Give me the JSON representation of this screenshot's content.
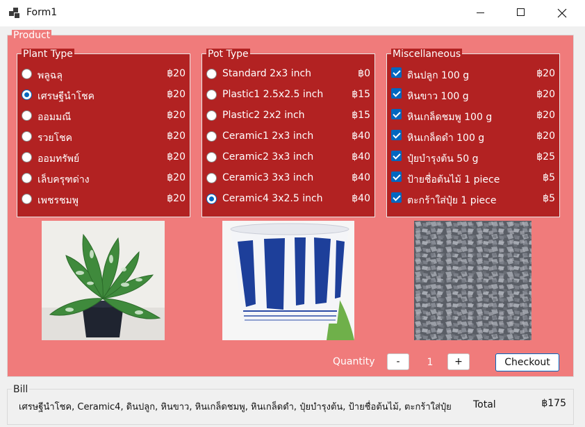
{
  "window": {
    "title": "Form1"
  },
  "product": {
    "legend": "Product",
    "plant": {
      "legend": "Plant Type",
      "options": [
        {
          "label": "พลูฉลุ",
          "price": "฿20",
          "selected": false
        },
        {
          "label": "เศรษฐีนำโชค",
          "price": "฿20",
          "selected": true
        },
        {
          "label": "ออมมณี",
          "price": "฿20",
          "selected": false
        },
        {
          "label": "รวยโชค",
          "price": "฿20",
          "selected": false
        },
        {
          "label": "ออมทรัพย์",
          "price": "฿20",
          "selected": false
        },
        {
          "label": "เล็บครุฑด่าง",
          "price": "฿20",
          "selected": false
        },
        {
          "label": "เพชรชมพู",
          "price": "฿20",
          "selected": false
        }
      ]
    },
    "pot": {
      "legend": "Pot Type",
      "options": [
        {
          "label": "Standard 2x3 inch",
          "price": "฿0",
          "selected": false
        },
        {
          "label": "Plastic1 2.5x2.5 inch",
          "price": "฿15",
          "selected": false
        },
        {
          "label": "Plastic2 2x2 inch",
          "price": "฿15",
          "selected": false
        },
        {
          "label": "Ceramic1 2x3 inch",
          "price": "฿40",
          "selected": false
        },
        {
          "label": "Ceramic2 3x3 inch",
          "price": "฿40",
          "selected": false
        },
        {
          "label": "Ceramic3 3x3 inch",
          "price": "฿40",
          "selected": false
        },
        {
          "label": "Ceramic4 3x2.5 inch",
          "price": "฿40",
          "selected": true
        }
      ]
    },
    "misc": {
      "legend": "Miscellaneous",
      "options": [
        {
          "label": "ดินปลูก 100 g",
          "price": "฿20",
          "checked": true
        },
        {
          "label": "หินขาว 100 g",
          "price": "฿20",
          "checked": true
        },
        {
          "label": "หินเกล็ดชมพู 100 g",
          "price": "฿20",
          "checked": true
        },
        {
          "label": "หินเกล็ดดำ 100 g",
          "price": "฿20",
          "checked": true
        },
        {
          "label": "ปุ๋ยบำรุงต้น 50 g",
          "price": "฿25",
          "checked": true
        },
        {
          "label": "ป้ายชื่อต้นไม้ 1 piece",
          "price": "฿5",
          "checked": true
        },
        {
          "label": "ตะกร้าใส่ปุ๋ย 1 piece",
          "price": "฿5",
          "checked": true
        }
      ]
    },
    "quantity": {
      "label": "Quantity",
      "minus": "-",
      "value": "1",
      "plus": "+"
    },
    "checkout_label": "Checkout"
  },
  "bill": {
    "legend": "Bill",
    "items": "เศรษฐีนำโชค, Ceramic4, ดินปลูก, หินขาว, หินเกล็ดชมพู, หินเกล็ดดำ, ปุ๋ยบำรุงต้น, ป้ายชื่อต้นไม้, ตะกร้าใส่ปุ๋ย",
    "total_label": "Total",
    "total": "฿175"
  },
  "colors": {
    "panel": "#f07b7b",
    "group": "#b22222",
    "accent": "#0067c0"
  }
}
